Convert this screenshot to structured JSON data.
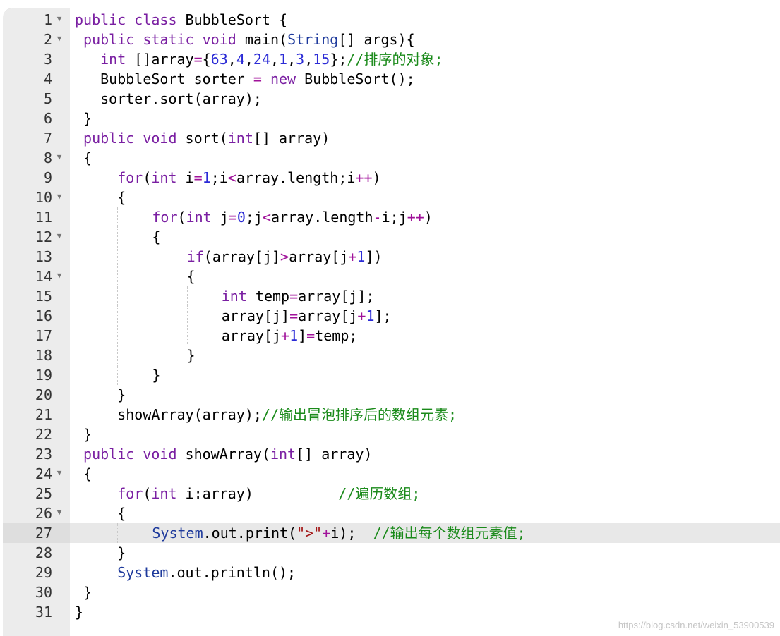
{
  "editor": {
    "language": "java",
    "active_line": 27,
    "watermark": "https://blog.csdn.net/weixin_53900539",
    "lines": [
      {
        "n": "1",
        "fold": true,
        "code": "public class BubbleSort {"
      },
      {
        "n": "2",
        "fold": true,
        "code": " public static void main(String[] args){"
      },
      {
        "n": "3",
        "fold": false,
        "code": "   int []array={63,4,24,1,3,15};//排序的对象;"
      },
      {
        "n": "4",
        "fold": false,
        "code": "   BubbleSort sorter = new BubbleSort();"
      },
      {
        "n": "5",
        "fold": false,
        "code": "   sorter.sort(array);"
      },
      {
        "n": "6",
        "fold": false,
        "code": " }"
      },
      {
        "n": "7",
        "fold": false,
        "code": " public void sort(int[] array)"
      },
      {
        "n": "8",
        "fold": true,
        "code": " {"
      },
      {
        "n": "9",
        "fold": false,
        "code": "     for(int i=1;i<array.length;i++)"
      },
      {
        "n": "10",
        "fold": true,
        "code": "     {"
      },
      {
        "n": "11",
        "fold": false,
        "code": "         for(int j=0;j<array.length-i;j++)"
      },
      {
        "n": "12",
        "fold": true,
        "code": "         {"
      },
      {
        "n": "13",
        "fold": false,
        "code": "             if(array[j]>array[j+1])"
      },
      {
        "n": "14",
        "fold": true,
        "code": "             {"
      },
      {
        "n": "15",
        "fold": false,
        "code": "                 int temp=array[j];"
      },
      {
        "n": "16",
        "fold": false,
        "code": "                 array[j]=array[j+1];"
      },
      {
        "n": "17",
        "fold": false,
        "code": "                 array[j+1]=temp;"
      },
      {
        "n": "18",
        "fold": false,
        "code": "             }"
      },
      {
        "n": "19",
        "fold": false,
        "code": "         }"
      },
      {
        "n": "20",
        "fold": false,
        "code": "     }"
      },
      {
        "n": "21",
        "fold": false,
        "code": "     showArray(array);//输出冒泡排序后的数组元素;"
      },
      {
        "n": "22",
        "fold": false,
        "code": " }"
      },
      {
        "n": "23",
        "fold": false,
        "code": " public void showArray(int[] array)"
      },
      {
        "n": "24",
        "fold": true,
        "code": " {"
      },
      {
        "n": "25",
        "fold": false,
        "code": "     for(int i:array)          //遍历数组;"
      },
      {
        "n": "26",
        "fold": true,
        "code": "     {"
      },
      {
        "n": "27",
        "fold": false,
        "code": "         System.out.print(\">\"+i);  //输出每个数组元素值;"
      },
      {
        "n": "28",
        "fold": false,
        "code": "     }"
      },
      {
        "n": "29",
        "fold": false,
        "code": "     System.out.println();"
      },
      {
        "n": "30",
        "fold": false,
        "code": " }"
      },
      {
        "n": "31",
        "fold": false,
        "code": "}"
      }
    ]
  }
}
